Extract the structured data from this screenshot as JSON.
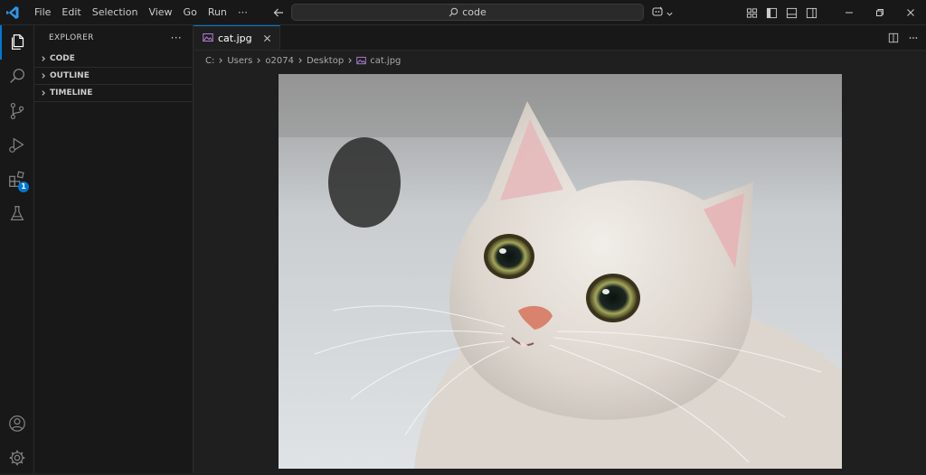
{
  "titlebar": {
    "menu": [
      "File",
      "Edit",
      "Selection",
      "View",
      "Go",
      "Run",
      "⋯"
    ],
    "search_text": "code"
  },
  "activity": {
    "extensions_badge": "1"
  },
  "sidebar": {
    "title": "EXPLORER",
    "more": "···",
    "sections": [
      "CODE",
      "OUTLINE",
      "TIMELINE"
    ]
  },
  "editor": {
    "tab_label": "cat.jpg",
    "breadcrumb": [
      "C:",
      "Users",
      "o2074",
      "Desktop",
      "cat.jpg"
    ]
  },
  "colors": {
    "accent": "#0078d4",
    "background": "#1f1f1f",
    "chrome": "#181818"
  }
}
